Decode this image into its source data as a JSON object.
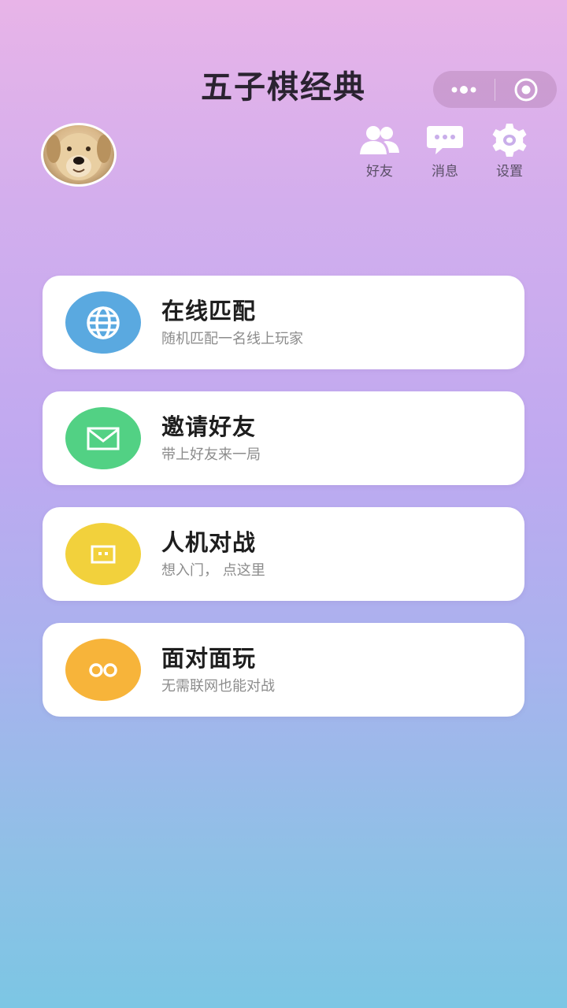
{
  "app": {
    "title": "五子棋经典"
  },
  "header": {
    "friends_label": "好友",
    "messages_label": "消息",
    "settings_label": "设置"
  },
  "menu": {
    "items": [
      {
        "title": "在线匹配",
        "subtitle": "随机匹配一名线上玩家",
        "icon": "globe-icon",
        "color": "#5aa9e0"
      },
      {
        "title": "邀请好友",
        "subtitle": "带上好友来一局",
        "icon": "mail-icon",
        "color": "#52d184"
      },
      {
        "title": "人机对战",
        "subtitle": "想入门， 点这里",
        "icon": "robot-icon",
        "color": "#f2d13c"
      },
      {
        "title": "面对面玩",
        "subtitle": "无需联网也能对战",
        "icon": "infinity-icon",
        "color": "#f7b43a"
      }
    ]
  },
  "colors": {
    "background_top": "#e8b4e8",
    "background_bottom": "#7cc6e4"
  }
}
